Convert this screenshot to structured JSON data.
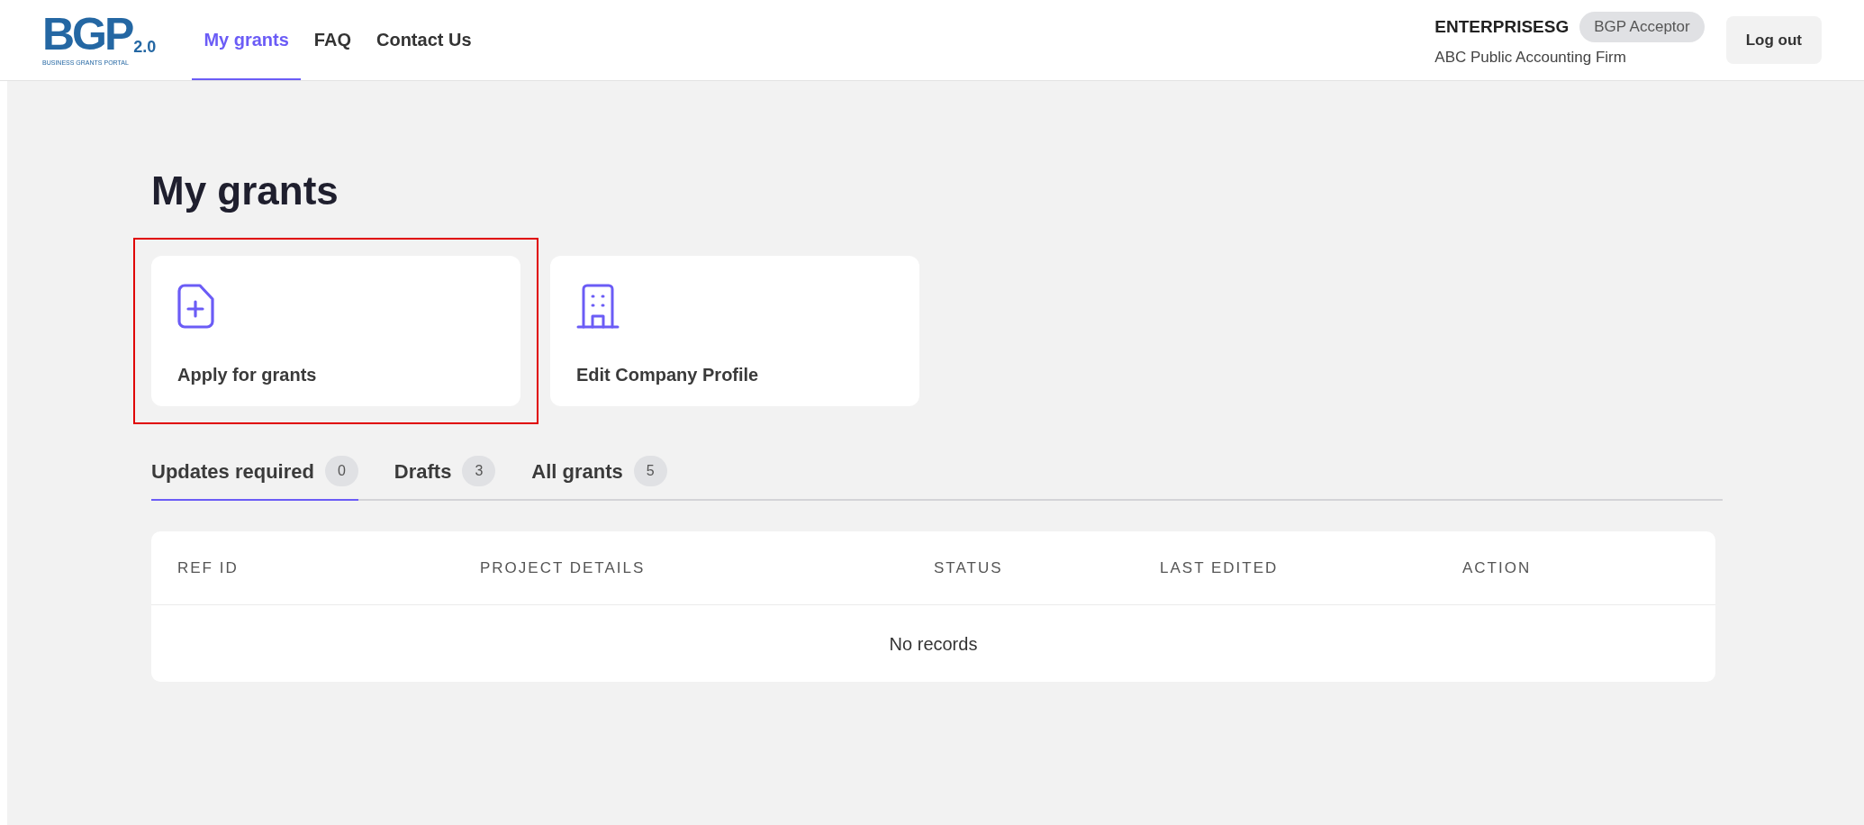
{
  "header": {
    "logo": {
      "mark": "BGP",
      "version": "2.0",
      "tagline": "BUSINESS GRANTS PORTAL"
    },
    "nav": [
      {
        "label": "My grants",
        "selected": true
      },
      {
        "label": "FAQ",
        "selected": false
      },
      {
        "label": "Contact Us",
        "selected": false
      }
    ],
    "user": {
      "name": "ENTERPRISESG",
      "role": "BGP Acceptor",
      "company": "ABC Public Accounting Firm"
    },
    "logout": "Log out"
  },
  "title": "My grants",
  "cards": [
    {
      "kind": "file-plus",
      "label": "Apply for grants",
      "highlighted": true
    },
    {
      "kind": "building",
      "label": "Edit Company Profile",
      "highlighted": false
    }
  ],
  "tabs": [
    {
      "label": "Updates required",
      "count": "0",
      "selected": true
    },
    {
      "label": "Drafts",
      "count": "3",
      "selected": false
    },
    {
      "label": "All grants",
      "count": "5",
      "selected": false
    }
  ],
  "table": {
    "columns": [
      "REF ID",
      "PROJECT DETAILS",
      "STATUS",
      "LAST EDITED",
      "ACTION"
    ],
    "empty": "No records"
  }
}
